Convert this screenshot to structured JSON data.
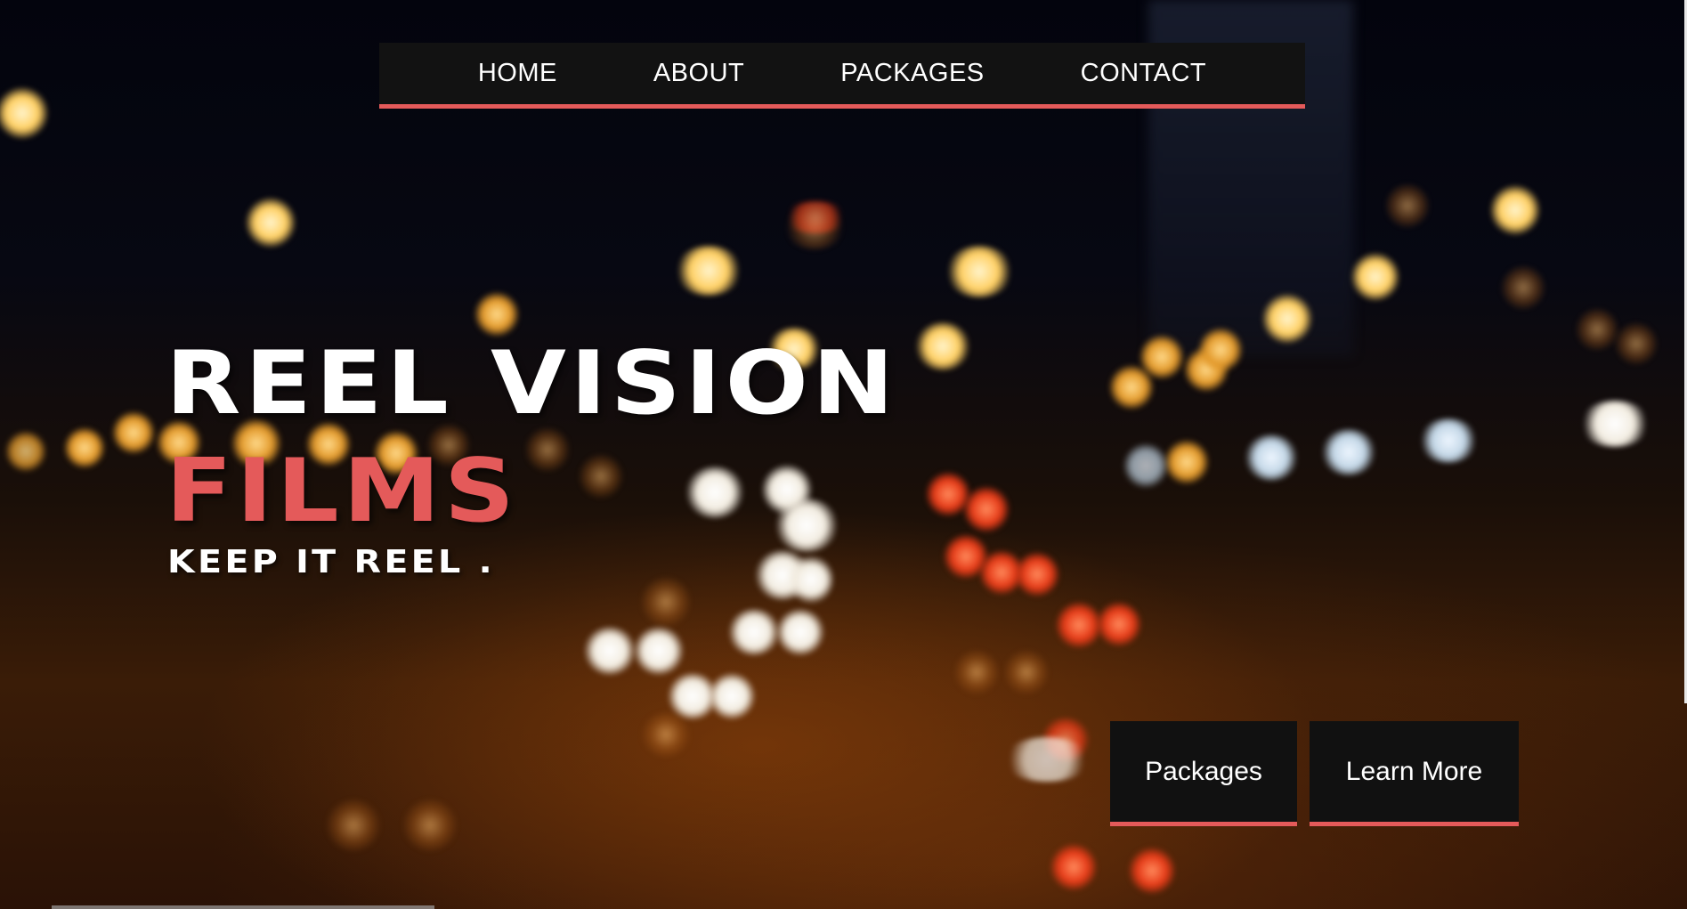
{
  "nav": {
    "items": [
      {
        "label": "HOME"
      },
      {
        "label": "ABOUT"
      },
      {
        "label": "PACKAGES"
      },
      {
        "label": "CONTACT"
      }
    ]
  },
  "hero": {
    "title_line1": "REEL VISION",
    "title_line2": "FILMS",
    "tagline": "KEEP IT REEL ."
  },
  "cta": {
    "packages_label": "Packages",
    "learn_more_label": "Learn More"
  },
  "colors": {
    "accent": "#e45a5a",
    "nav_background": "#121212",
    "button_background": "#111111",
    "text": "#ffffff"
  },
  "background": {
    "icon": "night-city-bokeh-background"
  }
}
